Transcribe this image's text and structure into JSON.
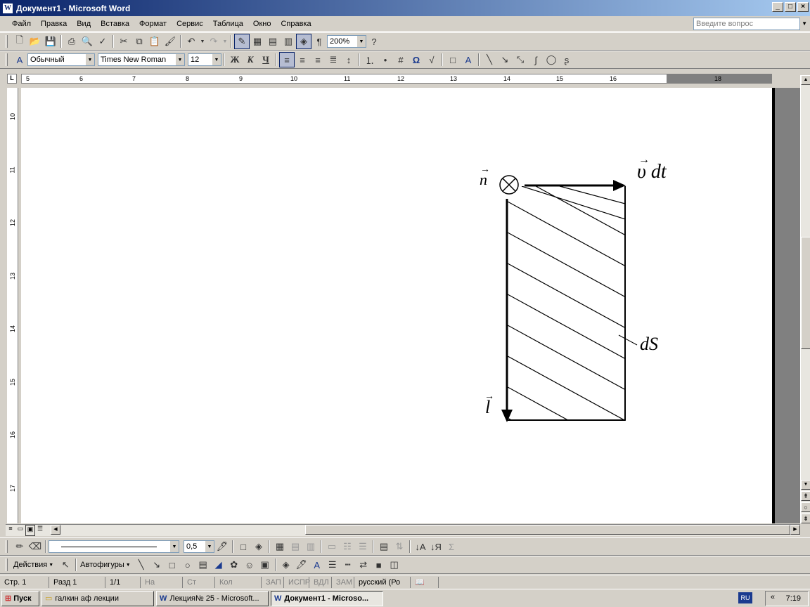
{
  "window": {
    "title": "Документ1 - Microsoft Word",
    "app_icon": "W"
  },
  "menu": [
    "Файл",
    "Правка",
    "Вид",
    "Вставка",
    "Формат",
    "Сервис",
    "Таблица",
    "Окно",
    "Справка"
  ],
  "ask_placeholder": "Введите вопрос",
  "standard_toolbar": {
    "zoom": "200%",
    "pilcrow": "¶"
  },
  "format_toolbar": {
    "style": "Обычный",
    "font": "Times New Roman",
    "size": "12",
    "bold": "Ж",
    "italic": "К",
    "underline": "Ч"
  },
  "ruler": {
    "numbers": [
      "5",
      "6",
      "7",
      "8",
      "9",
      "10",
      "11",
      "12",
      "13",
      "14",
      "15",
      "16",
      "18"
    ]
  },
  "vruler": {
    "numbers": [
      "10",
      "11",
      "12",
      "13",
      "14",
      "15",
      "16",
      "17"
    ]
  },
  "figure": {
    "n_label": "n",
    "v_label": "υ dt",
    "ds_label": "dS",
    "l_label": "l"
  },
  "drawing_toolbar": {
    "line_width": "0,5",
    "actions": "Действия",
    "autoshapes": "Автофигуры"
  },
  "status": {
    "page": "Стр. 1",
    "section": "Разд 1",
    "pages": "1/1",
    "at": "На",
    "line": "Ст",
    "col": "Кол",
    "rec": "ЗАП",
    "trk": "ИСПР",
    "ext": "ВДЛ",
    "ovr": "ЗАМ",
    "lang": "русский (Ро"
  },
  "taskbar": {
    "start": "Пуск",
    "tasks": [
      "галкин аф лекции",
      "Лекция№ 25 - Microsoft...",
      "Документ1 - Microso..."
    ],
    "lang": "RU",
    "time": "7:19",
    "chevron": "«"
  }
}
